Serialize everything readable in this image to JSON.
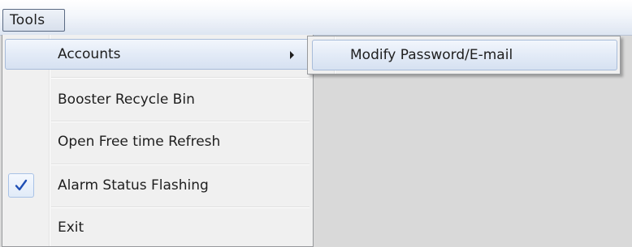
{
  "menubar": {
    "tools_label": "Tools"
  },
  "tools_menu": {
    "items": [
      {
        "label": "Accounts",
        "has_submenu": true,
        "highlighted": true
      },
      {
        "label": "Booster Recycle Bin"
      },
      {
        "label": "Open Free time Refresh"
      },
      {
        "label": "Alarm Status Flashing",
        "checked": true
      },
      {
        "label": "Exit"
      }
    ]
  },
  "accounts_submenu": {
    "items": [
      {
        "label": "Modify Password/E-mail",
        "highlighted": true
      }
    ]
  },
  "colors": {
    "checkmark": "#1f4fb5",
    "highlight_border": "#a8bcd9",
    "menu_background": "#f0f0f0",
    "window_background": "#d9d9d9"
  },
  "icons": {
    "submenu_arrow": "chevron-right-icon",
    "check": "checkmark-icon"
  }
}
